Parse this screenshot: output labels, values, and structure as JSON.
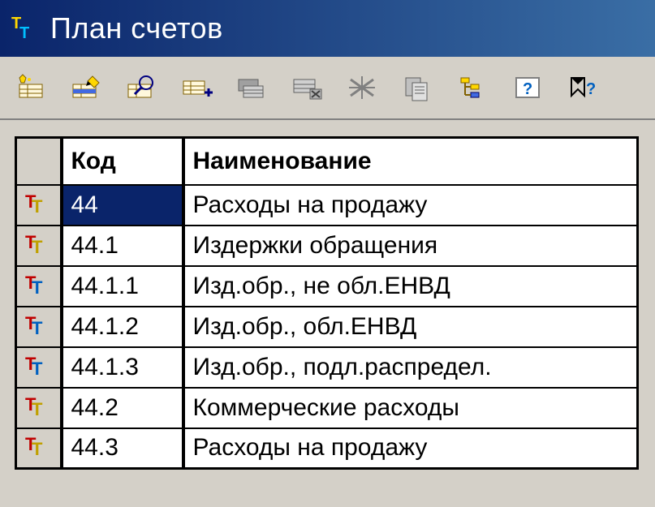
{
  "window": {
    "title": "План счетов"
  },
  "toolbar": {
    "buttons": [
      {
        "name": "new-line-button"
      },
      {
        "name": "edit-button"
      },
      {
        "name": "view-button"
      },
      {
        "name": "add-button"
      },
      {
        "name": "copy-button"
      },
      {
        "name": "delete-button"
      },
      {
        "name": "mark-delete-button"
      },
      {
        "name": "copy-clipboard-button"
      },
      {
        "name": "hierarchy-button"
      },
      {
        "name": "help-button"
      },
      {
        "name": "tips-button"
      }
    ]
  },
  "table": {
    "headers": {
      "code": "Код",
      "name": "Наименование"
    },
    "rows": [
      {
        "icon": "yellow",
        "code": "44",
        "name": "Расходы на продажу",
        "selected": true
      },
      {
        "icon": "yellow",
        "code": "44.1",
        "name": "Издержки обращения",
        "selected": false
      },
      {
        "icon": "blue",
        "code": "44.1.1",
        "name": "Изд.обр., не обл.ЕНВД",
        "selected": false
      },
      {
        "icon": "blue",
        "code": "44.1.2",
        "name": "Изд.обр., обл.ЕНВД",
        "selected": false
      },
      {
        "icon": "blue",
        "code": "44.1.3",
        "name": "Изд.обр., подл.распредел.",
        "selected": false
      },
      {
        "icon": "yellow",
        "code": "44.2",
        "name": "Коммерческие расходы",
        "selected": false
      },
      {
        "icon": "yellow",
        "code": "44.3",
        "name": "Расходы на продажу",
        "selected": false
      }
    ]
  }
}
